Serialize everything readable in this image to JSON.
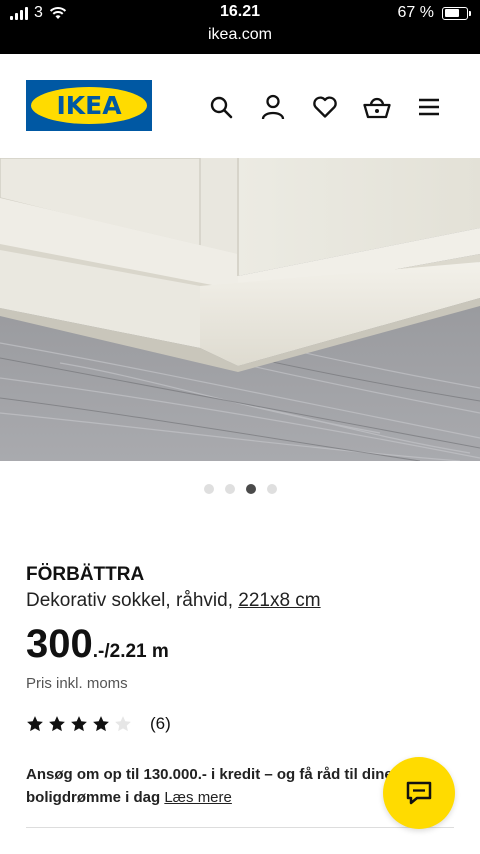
{
  "status_bar": {
    "carrier": "3",
    "time": "16.21",
    "url": "ikea.com",
    "battery": "67 %",
    "battery_level": 0.67
  },
  "header": {
    "logo_text": "IKEA",
    "icons": [
      "search-icon",
      "account-icon",
      "favorites-icon",
      "basket-icon",
      "menu-icon"
    ]
  },
  "gallery": {
    "image_count": 4,
    "active_index": 2
  },
  "product": {
    "name": "FÖRBÄTTRA",
    "description": "Dekorativ sokkel, råhvid, ",
    "size": "221x8 cm",
    "price_main": "300",
    "price_suffix": ".-/2.21 m",
    "vat_note": "Pris inkl. moms",
    "rating": 4,
    "rating_max": 5,
    "review_count": "(6)"
  },
  "credit": {
    "text": "Ansøg om op til 130.000.- i kredit – og få råd til dine boligdrømme i dag ",
    "link": "Læs mere"
  },
  "colors": {
    "ikea_blue": "#0058a3",
    "ikea_yellow": "#ffdb00"
  }
}
